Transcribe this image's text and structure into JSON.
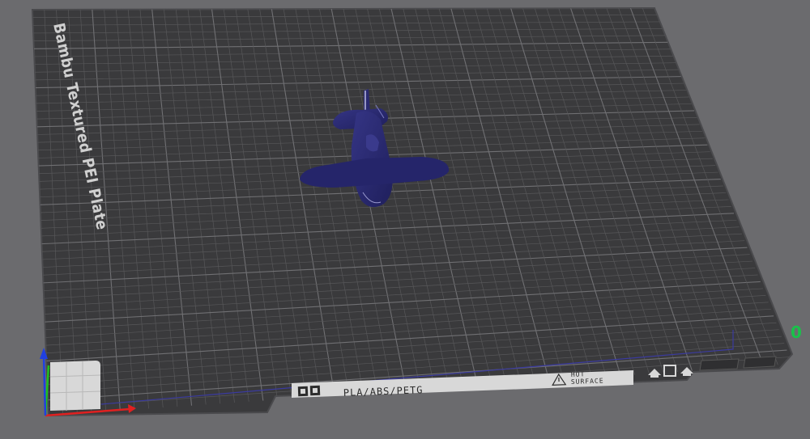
{
  "plate": {
    "name_label": "Bambu Textured PEI Plate",
    "material_label": "PLA/ABS/PETG",
    "warning_line1": "HOT",
    "warning_line2": "SURFACE",
    "origin_marker": "0"
  },
  "colors": {
    "background": "#6b6b6e",
    "plate": "#3a3a3c",
    "plate_border": "#4a4a4d",
    "grid_minor": "#5a5a5d",
    "grid_major": "#727275",
    "model": "#2a2a6e",
    "axis_x": "#e02020",
    "axis_y": "#20c020",
    "axis_z": "#2040e0",
    "origin_marker": "#19c24a",
    "label_strip": "#d8d8d8"
  },
  "icons": {
    "brand_logo": "bambu-logo-icon",
    "warning": "warning-triangle-icon",
    "plate_clip": "plate-clip-icon"
  }
}
